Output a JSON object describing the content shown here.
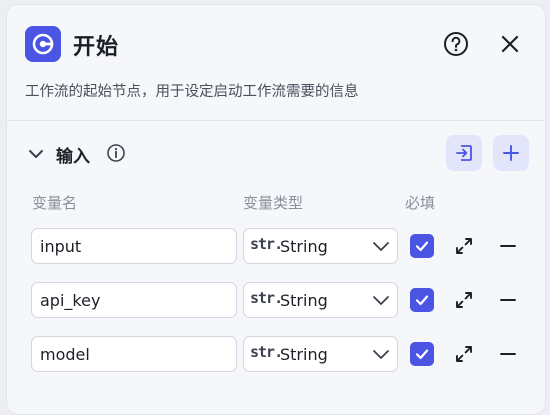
{
  "node": {
    "title": "开始",
    "description": "工作流的起始节点，用于设定启动工作流需要的信息",
    "icon": "start-node-icon",
    "accent": "#4b55e3"
  },
  "header_actions": {
    "help_icon": "question-circle-icon",
    "close_icon": "close-icon"
  },
  "inputs_section": {
    "title": "输入",
    "info_icon": "info-icon",
    "collapse_icon": "chevron-down-icon",
    "import_icon": "import-icon",
    "add_icon": "plus-icon",
    "columns": {
      "name": "变量名",
      "type": "变量类型",
      "required": "必填"
    },
    "rows": [
      {
        "name": "input",
        "type_prefix": "str.",
        "type": "String",
        "required": true
      },
      {
        "name": "api_key",
        "type_prefix": "str.",
        "type": "String",
        "required": true
      },
      {
        "name": "model",
        "type_prefix": "str.",
        "type": "String",
        "required": true
      }
    ]
  }
}
